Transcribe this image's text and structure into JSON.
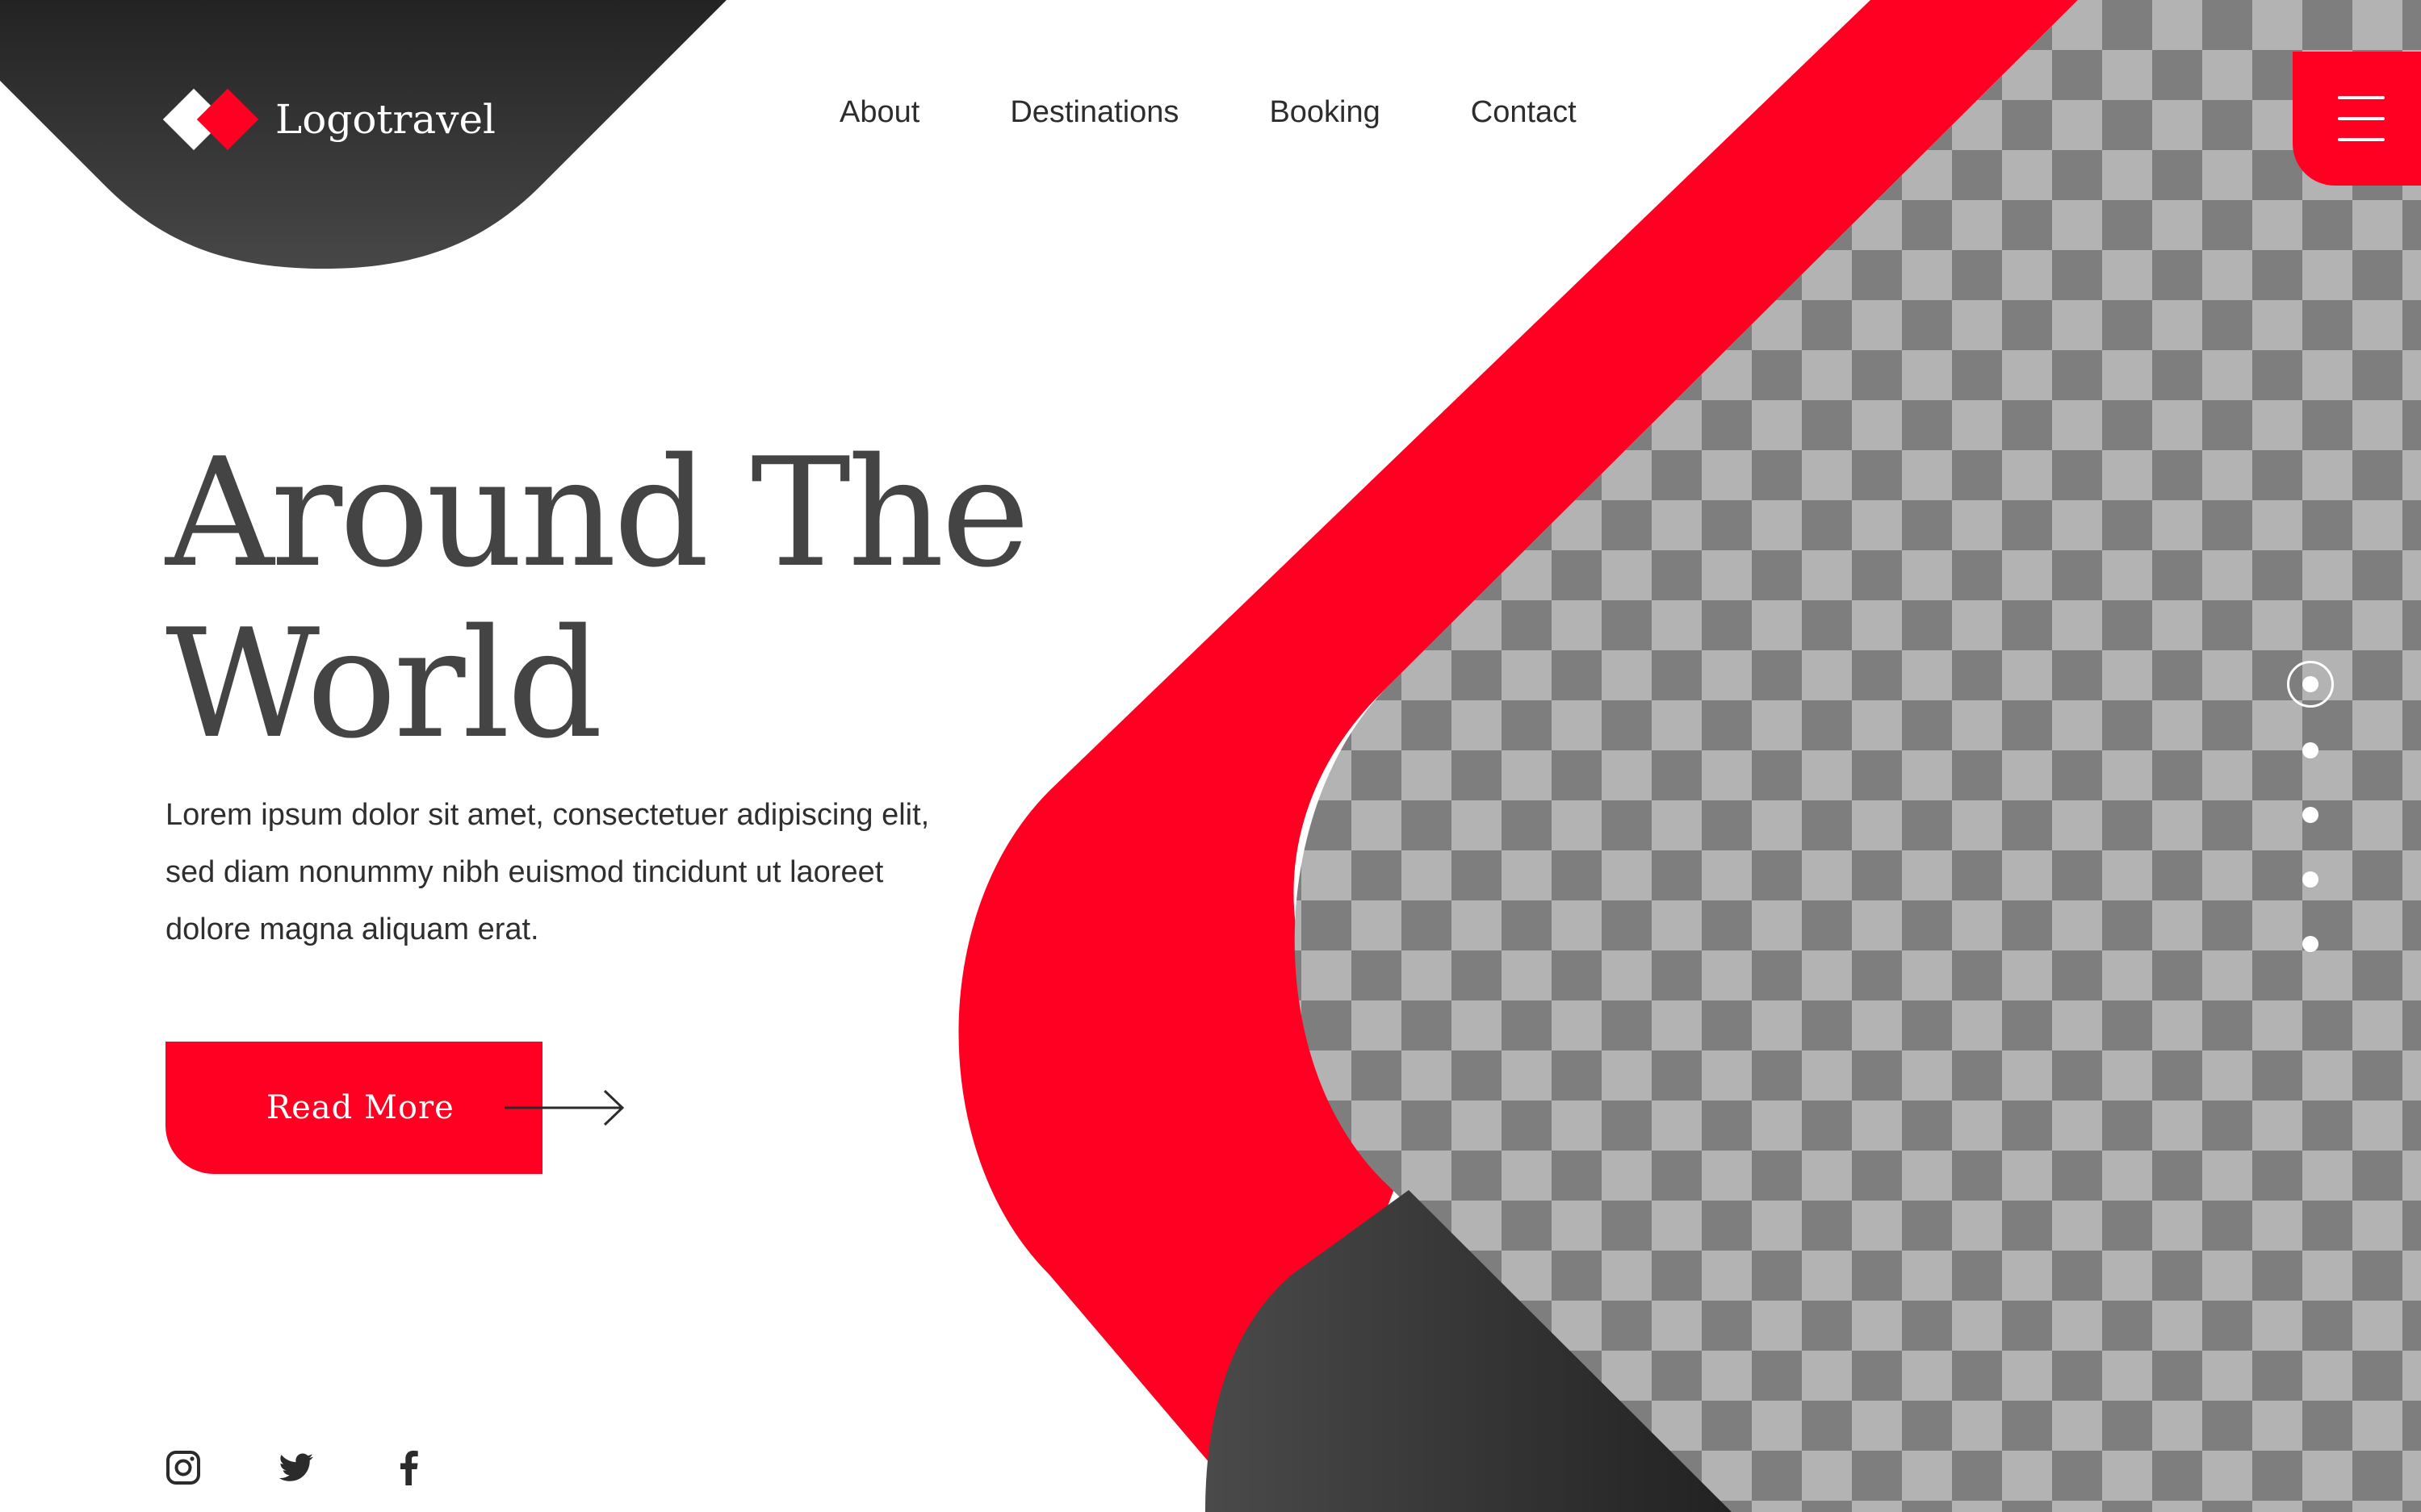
{
  "brand": {
    "name": "Logotravel"
  },
  "nav": {
    "items": [
      "About",
      "Destinations",
      "Booking",
      "Contact"
    ]
  },
  "hero": {
    "title_line1": "Around The",
    "title_line2": "World",
    "body": "Lorem ipsum dolor sit amet, consectetuer adipiscing elit, sed diam nonummy nibh euismod tincidunt ut laoreet dolore magna aliquam erat.",
    "cta_label": "Read More"
  },
  "slider": {
    "dot_count": 5,
    "active_index": 0
  },
  "socials": [
    "instagram-icon",
    "twitter-icon",
    "facebook-icon"
  ],
  "icons": {
    "menu": "hamburger-icon",
    "arrow": "arrow-right-icon",
    "logo": "diamond-logo-icon"
  },
  "colors": {
    "accent": "#ff0022",
    "dark": "#2b2b2b",
    "text": "#444444",
    "checker_light": "#b3b3b4",
    "checker_dark": "#7e7e7e",
    "background": "#ffffff"
  }
}
